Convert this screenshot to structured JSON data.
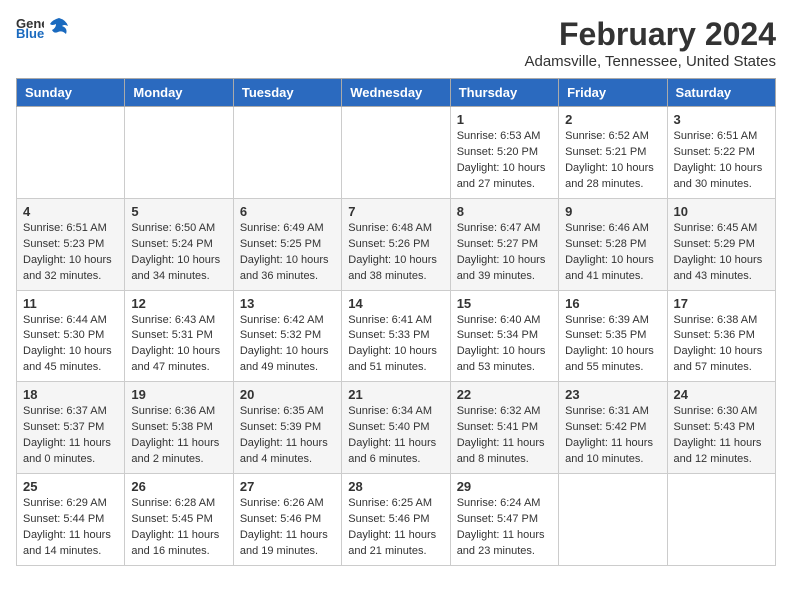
{
  "header": {
    "logo_general": "General",
    "logo_blue": "Blue",
    "title": "February 2024",
    "subtitle": "Adamsville, Tennessee, United States"
  },
  "days_of_week": [
    "Sunday",
    "Monday",
    "Tuesday",
    "Wednesday",
    "Thursday",
    "Friday",
    "Saturday"
  ],
  "weeks": [
    [
      {
        "day": "",
        "info": ""
      },
      {
        "day": "",
        "info": ""
      },
      {
        "day": "",
        "info": ""
      },
      {
        "day": "",
        "info": ""
      },
      {
        "day": "1",
        "info": "Sunrise: 6:53 AM\nSunset: 5:20 PM\nDaylight: 10 hours\nand 27 minutes."
      },
      {
        "day": "2",
        "info": "Sunrise: 6:52 AM\nSunset: 5:21 PM\nDaylight: 10 hours\nand 28 minutes."
      },
      {
        "day": "3",
        "info": "Sunrise: 6:51 AM\nSunset: 5:22 PM\nDaylight: 10 hours\nand 30 minutes."
      }
    ],
    [
      {
        "day": "4",
        "info": "Sunrise: 6:51 AM\nSunset: 5:23 PM\nDaylight: 10 hours\nand 32 minutes."
      },
      {
        "day": "5",
        "info": "Sunrise: 6:50 AM\nSunset: 5:24 PM\nDaylight: 10 hours\nand 34 minutes."
      },
      {
        "day": "6",
        "info": "Sunrise: 6:49 AM\nSunset: 5:25 PM\nDaylight: 10 hours\nand 36 minutes."
      },
      {
        "day": "7",
        "info": "Sunrise: 6:48 AM\nSunset: 5:26 PM\nDaylight: 10 hours\nand 38 minutes."
      },
      {
        "day": "8",
        "info": "Sunrise: 6:47 AM\nSunset: 5:27 PM\nDaylight: 10 hours\nand 39 minutes."
      },
      {
        "day": "9",
        "info": "Sunrise: 6:46 AM\nSunset: 5:28 PM\nDaylight: 10 hours\nand 41 minutes."
      },
      {
        "day": "10",
        "info": "Sunrise: 6:45 AM\nSunset: 5:29 PM\nDaylight: 10 hours\nand 43 minutes."
      }
    ],
    [
      {
        "day": "11",
        "info": "Sunrise: 6:44 AM\nSunset: 5:30 PM\nDaylight: 10 hours\nand 45 minutes."
      },
      {
        "day": "12",
        "info": "Sunrise: 6:43 AM\nSunset: 5:31 PM\nDaylight: 10 hours\nand 47 minutes."
      },
      {
        "day": "13",
        "info": "Sunrise: 6:42 AM\nSunset: 5:32 PM\nDaylight: 10 hours\nand 49 minutes."
      },
      {
        "day": "14",
        "info": "Sunrise: 6:41 AM\nSunset: 5:33 PM\nDaylight: 10 hours\nand 51 minutes."
      },
      {
        "day": "15",
        "info": "Sunrise: 6:40 AM\nSunset: 5:34 PM\nDaylight: 10 hours\nand 53 minutes."
      },
      {
        "day": "16",
        "info": "Sunrise: 6:39 AM\nSunset: 5:35 PM\nDaylight: 10 hours\nand 55 minutes."
      },
      {
        "day": "17",
        "info": "Sunrise: 6:38 AM\nSunset: 5:36 PM\nDaylight: 10 hours\nand 57 minutes."
      }
    ],
    [
      {
        "day": "18",
        "info": "Sunrise: 6:37 AM\nSunset: 5:37 PM\nDaylight: 11 hours\nand 0 minutes."
      },
      {
        "day": "19",
        "info": "Sunrise: 6:36 AM\nSunset: 5:38 PM\nDaylight: 11 hours\nand 2 minutes."
      },
      {
        "day": "20",
        "info": "Sunrise: 6:35 AM\nSunset: 5:39 PM\nDaylight: 11 hours\nand 4 minutes."
      },
      {
        "day": "21",
        "info": "Sunrise: 6:34 AM\nSunset: 5:40 PM\nDaylight: 11 hours\nand 6 minutes."
      },
      {
        "day": "22",
        "info": "Sunrise: 6:32 AM\nSunset: 5:41 PM\nDaylight: 11 hours\nand 8 minutes."
      },
      {
        "day": "23",
        "info": "Sunrise: 6:31 AM\nSunset: 5:42 PM\nDaylight: 11 hours\nand 10 minutes."
      },
      {
        "day": "24",
        "info": "Sunrise: 6:30 AM\nSunset: 5:43 PM\nDaylight: 11 hours\nand 12 minutes."
      }
    ],
    [
      {
        "day": "25",
        "info": "Sunrise: 6:29 AM\nSunset: 5:44 PM\nDaylight: 11 hours\nand 14 minutes."
      },
      {
        "day": "26",
        "info": "Sunrise: 6:28 AM\nSunset: 5:45 PM\nDaylight: 11 hours\nand 16 minutes."
      },
      {
        "day": "27",
        "info": "Sunrise: 6:26 AM\nSunset: 5:46 PM\nDaylight: 11 hours\nand 19 minutes."
      },
      {
        "day": "28",
        "info": "Sunrise: 6:25 AM\nSunset: 5:46 PM\nDaylight: 11 hours\nand 21 minutes."
      },
      {
        "day": "29",
        "info": "Sunrise: 6:24 AM\nSunset: 5:47 PM\nDaylight: 11 hours\nand 23 minutes."
      },
      {
        "day": "",
        "info": ""
      },
      {
        "day": "",
        "info": ""
      }
    ]
  ]
}
